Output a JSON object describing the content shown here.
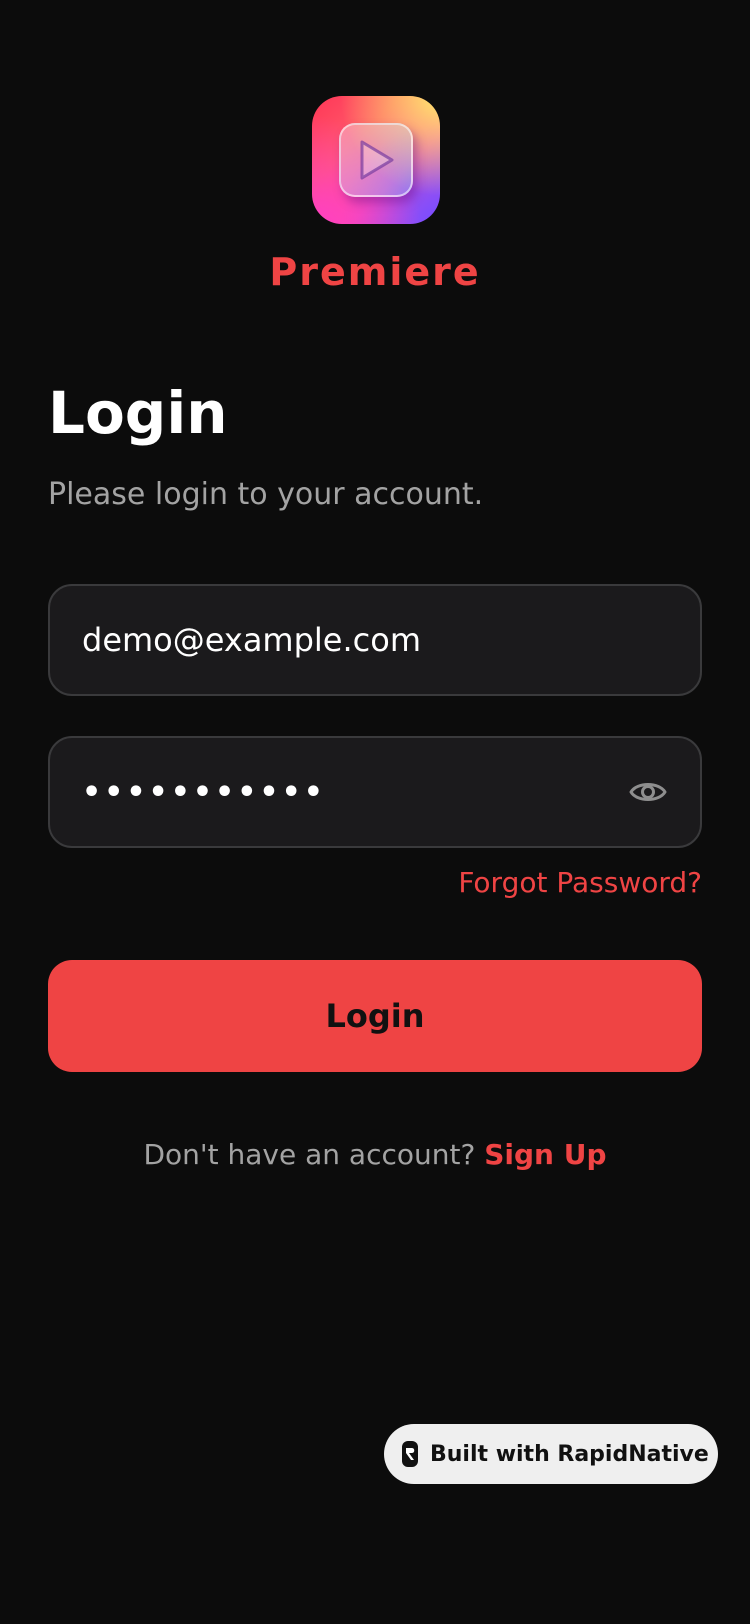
{
  "app": {
    "name": "Premiere",
    "icon": "play-icon"
  },
  "login": {
    "title": "Login",
    "subtitle": "Please login to your account.",
    "email_value": "demo@example.com",
    "password_value": "•••••••••••",
    "forgot_label": "Forgot Password?",
    "submit_label": "Login",
    "signup_prompt": "Don't have an account? ",
    "signup_label": "Sign Up"
  },
  "badge": {
    "label": "Built with RapidNative"
  },
  "colors": {
    "background": "#0c0c0c",
    "accent": "#ef4444",
    "field_bg": "#1b1a1c",
    "field_border": "#3a3a3c",
    "muted_text": "#a3a3a3"
  }
}
